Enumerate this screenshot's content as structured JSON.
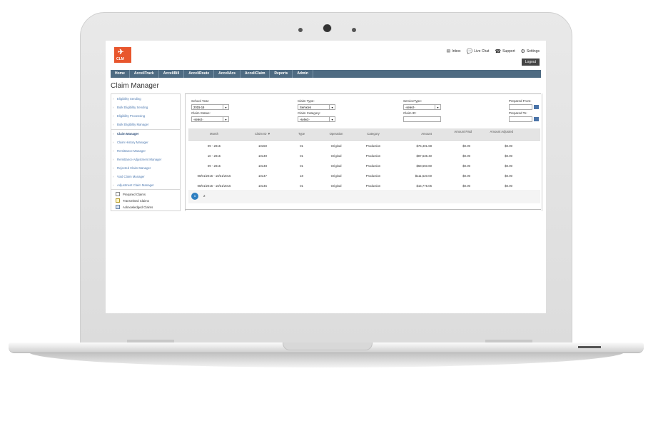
{
  "header": {
    "logo_text": "CLM",
    "links": [
      {
        "icon": "envelope-icon",
        "label": "Inbox"
      },
      {
        "icon": "chat-icon",
        "label": "Live Chat"
      },
      {
        "icon": "support-icon",
        "label": "Support"
      },
      {
        "icon": "gear-icon",
        "label": "Settings"
      }
    ],
    "logout": "Logout"
  },
  "nav": [
    "Home",
    "AcceliTrack",
    "AcceliBill",
    "AcceliRoute",
    "AcceliAcs",
    "AcceliClaim",
    "Reports",
    "Admin"
  ],
  "page_title": "Claim Manager",
  "sidebar": {
    "items": [
      "Eligibility Sending",
      "Bulk Eligibility Sending",
      "Eligibility Processing",
      "Bulk Eligibility Manager",
      "Claim Manager",
      "Claim History Manager",
      "Remittance Manager",
      "Remittance Adjustment Manager",
      "Rejected Claim Manager",
      "Void Claim Manager",
      "Adjustment Claim Manager"
    ],
    "legend": [
      "Prepared Claims",
      "Transmitted Claims",
      "Acknowledged Claims"
    ],
    "legend_colors": [
      "#ffffff",
      "#fff6c8",
      "#d7e3f2"
    ]
  },
  "filters": {
    "school_year_label": "School Year:",
    "school_year_value": "2015-16",
    "claim_type_label": "Claim Type:",
    "claim_type_value": "Services",
    "service_type_label": "ServiceType:",
    "service_type_value": "-select-",
    "prepared_from_label": "Prepared From:",
    "claim_status_label": "Claim Status:",
    "claim_status_value": "-select-",
    "claim_category_label": "Claim Category:",
    "claim_category_value": "-select-",
    "claim_id_label": "Claim ID:",
    "prepared_to_label": "Prepared To:"
  },
  "table": {
    "columns": [
      "Month",
      "Claim ID ▼",
      "Type",
      "Operation",
      "Category",
      "Amount",
      "Amount Paid",
      "Amount Adjusted"
    ],
    "rows": [
      [
        "09 - 2015",
        "10150",
        "01",
        "Original",
        "Production",
        "$75,401.68",
        "$0.00",
        "$0.00"
      ],
      [
        "10 - 2015",
        "10149",
        "01",
        "Original",
        "Production",
        "$87,635.40",
        "$0.00",
        "$0.00"
      ],
      [
        "09 - 2015",
        "10148",
        "01",
        "Original",
        "Production",
        "$58,660.80",
        "$0.00",
        "$0.00"
      ],
      [
        "08/01/2015 - 10/31/2015",
        "10147",
        "18",
        "Original",
        "Production",
        "$111,520.00",
        "$0.00",
        "$0.00"
      ],
      [
        "08/01/2015 - 10/31/2015",
        "10145",
        "01",
        "Original",
        "Production",
        "$15,775.06",
        "$0.00",
        "$0.00"
      ]
    ]
  },
  "pagination": {
    "current": "1",
    "next": "2"
  }
}
